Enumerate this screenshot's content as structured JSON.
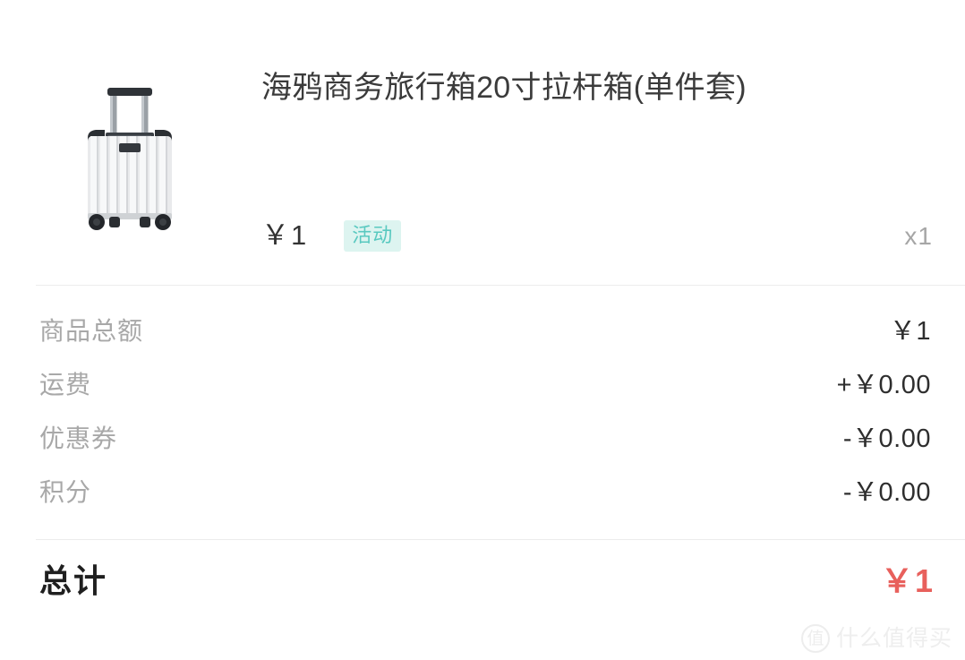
{
  "product": {
    "image_name": "silver-ribbed-carryon-suitcase",
    "title": "海鸦商务旅行箱20寸拉杆箱(单件套)",
    "price": "￥1",
    "tag": "活动",
    "quantity": "x1"
  },
  "summary": {
    "rows": [
      {
        "label": "商品总额",
        "value": "￥1"
      },
      {
        "label": "运费",
        "value": "+￥0.00"
      },
      {
        "label": "优惠券",
        "value": "-￥0.00"
      },
      {
        "label": "积分",
        "value": "-￥0.00"
      }
    ]
  },
  "total": {
    "label": "总计",
    "value": "￥1"
  },
  "watermark": {
    "mark": "值",
    "text": "什么值得买"
  },
  "colors": {
    "background": "#ffffff",
    "title_text": "#3b3b3b",
    "label_gray": "#a8a8a8",
    "value_dark": "#2e2e2e",
    "tag_background": "#ddf4f0",
    "tag_text": "#59c9c0",
    "total_red": "#e8605c",
    "divider": "#ececec",
    "watermark": "#eeeeee"
  }
}
